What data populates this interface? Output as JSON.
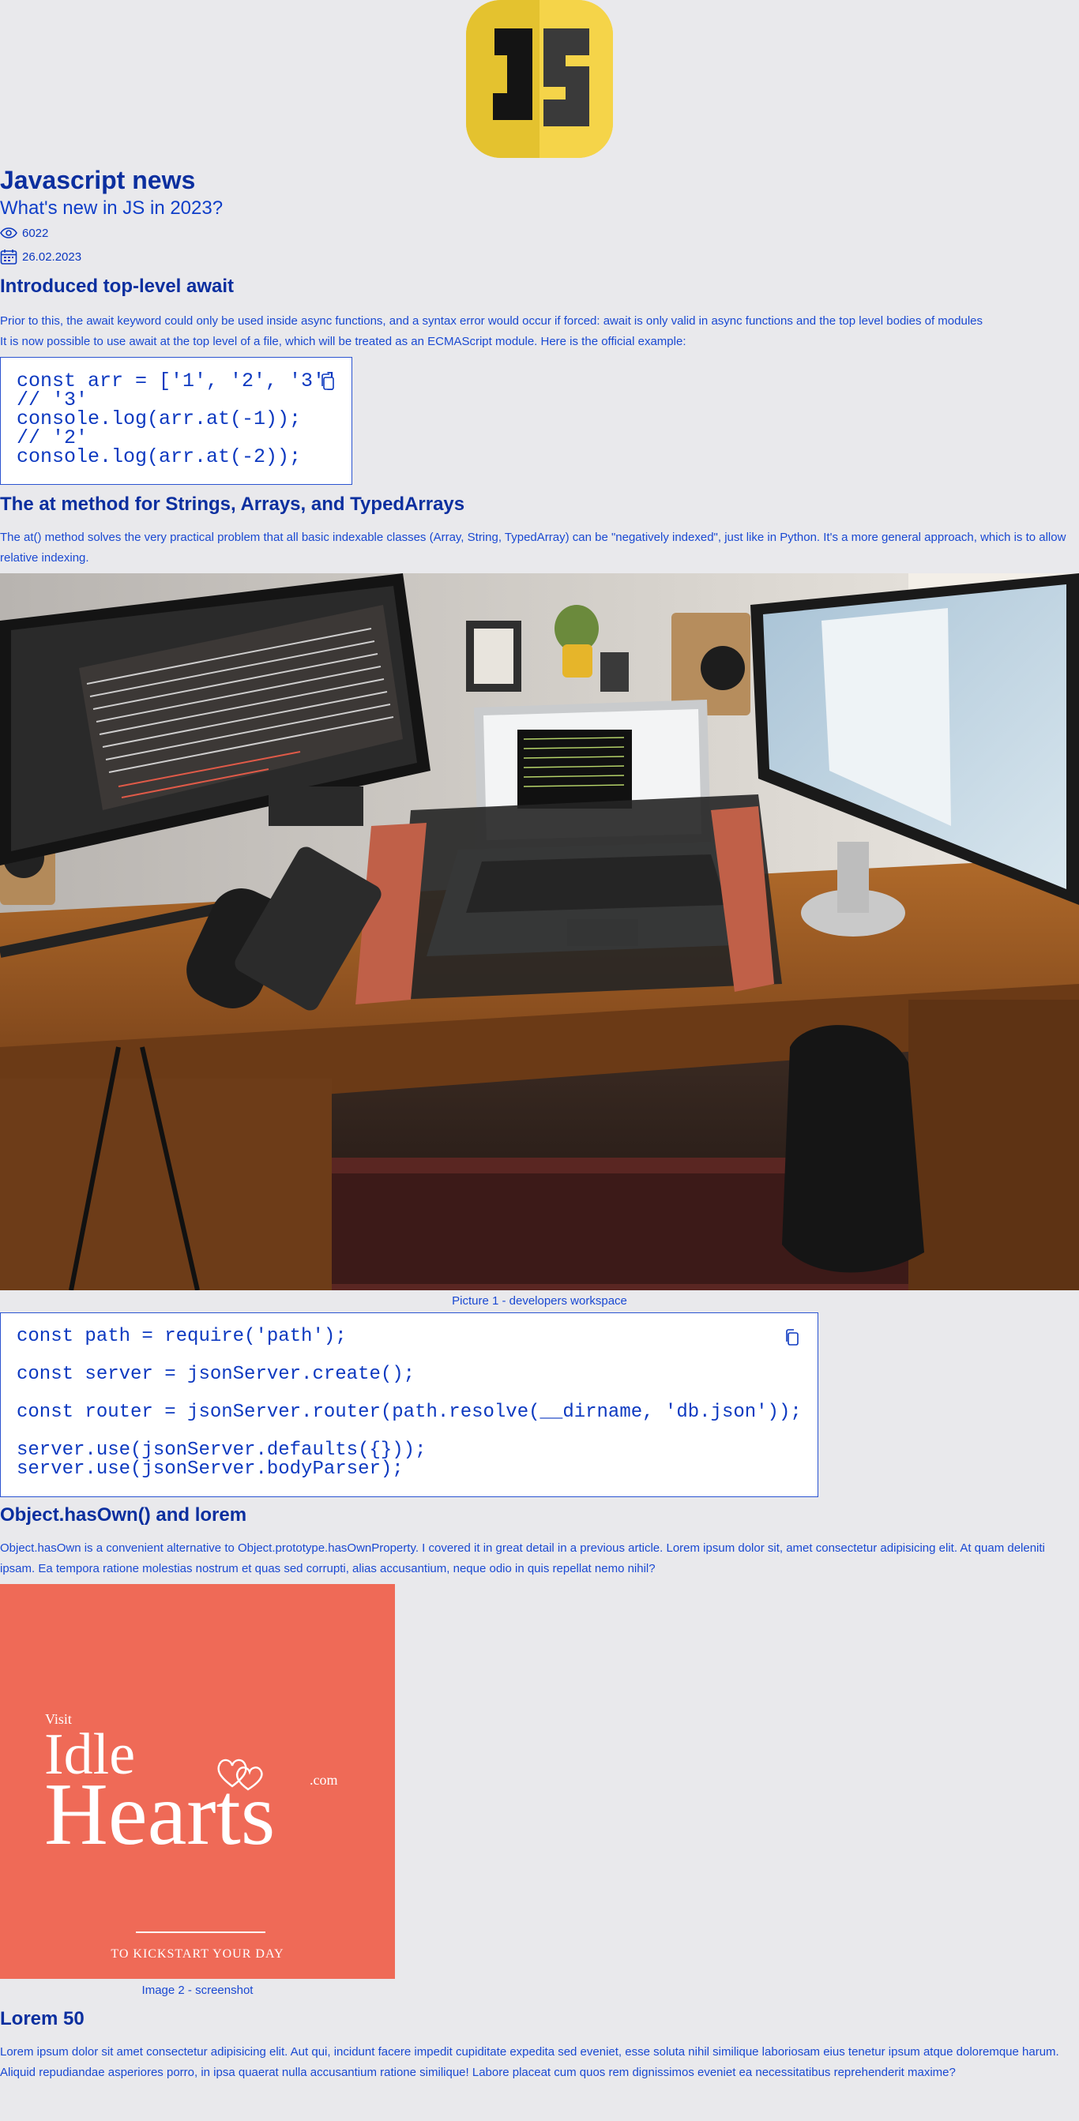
{
  "logo": {
    "name": "JS"
  },
  "article": {
    "site_title": "Javascript news",
    "subtitle": "What's new in JS in 2023?",
    "views": "6022",
    "date": "26.02.2023"
  },
  "section1": {
    "heading": "Introduced top-level await",
    "para1": "Prior to this, the await keyword could only be used inside async functions, and a syntax error would occur if forced: await is only valid in async functions and the top level bodies of modules",
    "para2": "It is now possible to use await at the top level of a file, which will be treated as an ECMAScript module. Here is the official example:",
    "code": "const arr = ['1', '2', '3']\n// '3'\nconsole.log(arr.at(-1));\n// '2'\nconsole.log(arr.at(-2));"
  },
  "section2": {
    "heading": "The at method for Strings, Arrays, and TypedArrays",
    "para1": "The at() method solves the very practical problem that all basic indexable classes (Array, String, TypedArray) can be \"negatively indexed\", just like in Python. It's a more general approach, which is to allow relative indexing.",
    "image_caption": "Picture 1 - developers workspace",
    "code": "const path = require('path');\n\nconst server = jsonServer.create();\n\nconst router = jsonServer.router(path.resolve(__dirname, 'db.json'));\n\nserver.use(jsonServer.defaults({}));\nserver.use(jsonServer.bodyParser);"
  },
  "section3": {
    "heading": "Object.hasOwn() and lorem",
    "para1": "Object.hasOwn is a convenient alternative to Object.prototype.hasOwnProperty. I covered it in great detail in a previous article. Lorem ipsum dolor sit, amet consectetur adipisicing elit. At quam deleniti ipsam. Ea tempora ratione molestias nostrum et quas sed corrupti, alias accusantium, neque odio in quis repellat nemo nihil?",
    "ad": {
      "visit": "Visit",
      "idle": "Idle",
      "hearts": "Hearts",
      "com": ".com",
      "tagline": "TO KICKSTART YOUR DAY"
    },
    "image_caption": "Image 2 - screenshot"
  },
  "section4": {
    "heading": "Lorem 50",
    "para1": "Lorem ipsum dolor sit amet consectetur adipisicing elit. Aut qui, incidunt facere impedit cupiditate expedita sed eveniet, esse soluta nihil similique laboriosam eius tenetur ipsum atque doloremque harum. Aliquid repudiandae asperiores porro, in ipsa quaerat nulla accusantium ratione similique! Labore placeat cum quos rem dignissimos eveniet ea necessitatibus reprehenderit maxime?"
  },
  "colors": {
    "background": "#e9e9ec",
    "text": "#0d39c0",
    "heading": "#0b2f9f",
    "ad_background": "#ef6a57",
    "logo_yellow": "#f0d33b"
  },
  "icons": [
    "eye-icon",
    "calendar-icon",
    "copy-icon"
  ]
}
